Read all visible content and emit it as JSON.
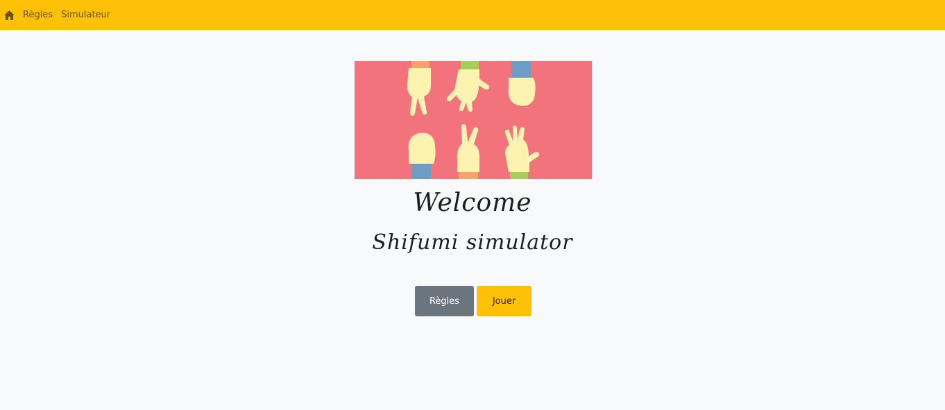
{
  "nav": {
    "home_icon": "home-icon",
    "links": [
      "Règles",
      "Simulateur"
    ]
  },
  "hero": {
    "title": "Welcome",
    "subtitle": "Shifumi simulator"
  },
  "buttons": {
    "rules": "Règles",
    "play": "Jouer"
  },
  "colors": {
    "navbar": "#ffc107",
    "banner_bg": "#f2737b",
    "hand": "#fdf3b0",
    "button_secondary": "#6c757d",
    "button_primary": "#ffc107"
  }
}
